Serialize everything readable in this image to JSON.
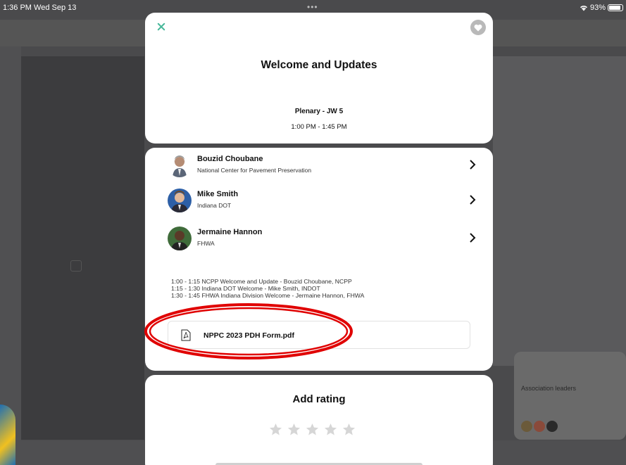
{
  "status_bar": {
    "time": "1:36 PM  Wed Sep 13",
    "dots": "•••",
    "battery": "93%"
  },
  "background": {
    "card_text": "Association leaders"
  },
  "session": {
    "title": "Welcome and Updates",
    "room": "Plenary - JW 5",
    "time": "1:00 PM - 1:45 PM"
  },
  "speakers": [
    {
      "name": "Bouzid Choubane",
      "org": "National Center for Pavement Preservation"
    },
    {
      "name": "Mike Smith",
      "org": "Indiana DOT"
    },
    {
      "name": "Jermaine Hannon",
      "org": "FHWA"
    }
  ],
  "agenda": [
    "1:00 - 1:15 NCPP Welcome and Update - Bouzid Choubane, NCPP",
    "1:15 - 1:30 Indiana DOT Welcome - Mike Smith, INDOT",
    "1:30 - 1:45 FHWA Indiana Division Welcome - Jermaine Hannon, FHWA"
  ],
  "attachment": {
    "filename": "NPPC 2023 PDH Form.pdf",
    "icon": "pdf-icon"
  },
  "rating": {
    "title": "Add rating",
    "max_stars": 5,
    "selected": 0
  },
  "colors": {
    "accent": "#48b89a",
    "highlight": "#e00000",
    "star_empty": "#d6d6d6"
  }
}
